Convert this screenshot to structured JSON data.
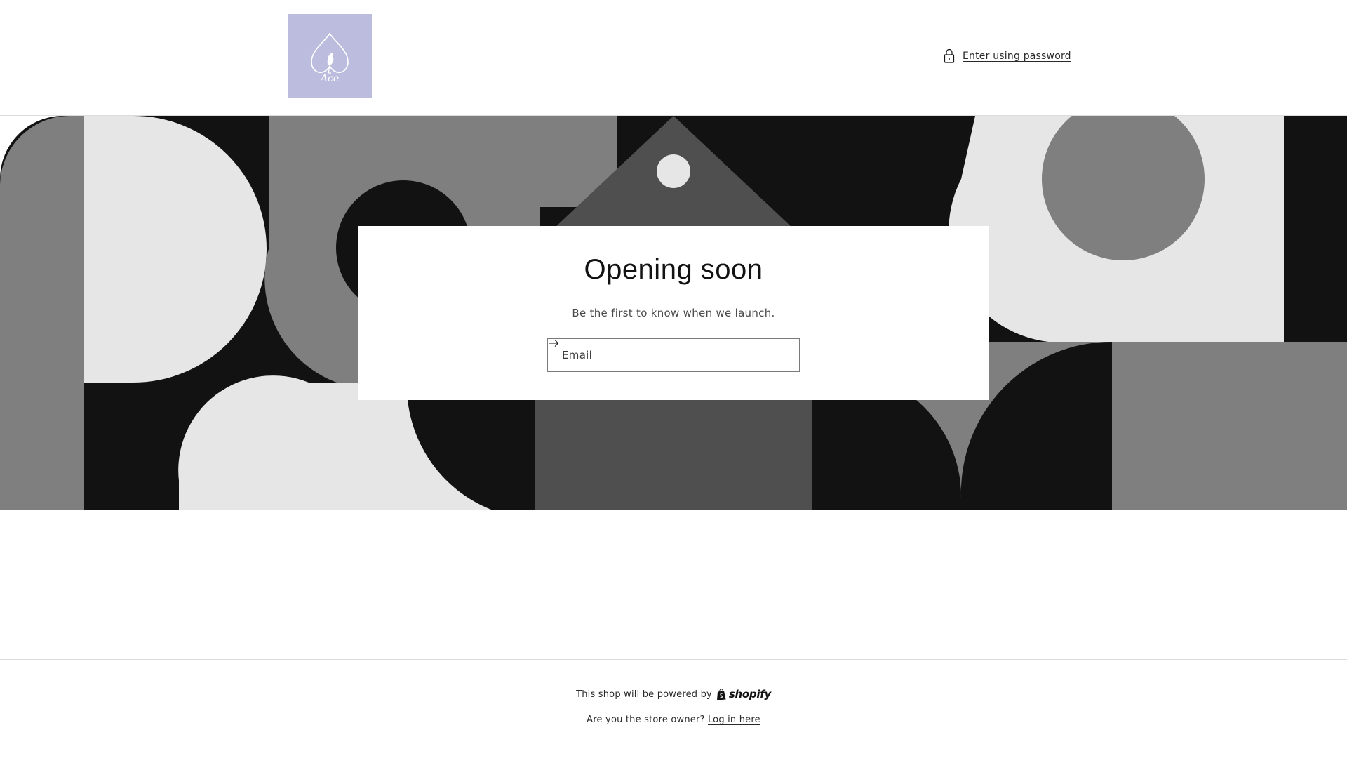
{
  "header": {
    "logo_alt": "Ace",
    "logo_text": "Ace",
    "password_link": "Enter using password"
  },
  "main": {
    "title": "Opening soon",
    "subtitle": "Be the first to know when we launch.",
    "email_placeholder": "Email"
  },
  "footer": {
    "powered_by": "This shop will be powered by",
    "brand": "shopify",
    "owner_question": "Are you the store owner?",
    "login_link": "Log in here"
  },
  "icons": {
    "password": "lock-icon",
    "submit": "arrow-right-icon",
    "brand": "shopify-bag-icon"
  },
  "colors": {
    "logo_bg": "#bbbcde",
    "black": "#121212",
    "gray_dark": "#4f4f4f",
    "gray_mid": "#7f7f7f",
    "gray_light": "#e6e6e6"
  }
}
